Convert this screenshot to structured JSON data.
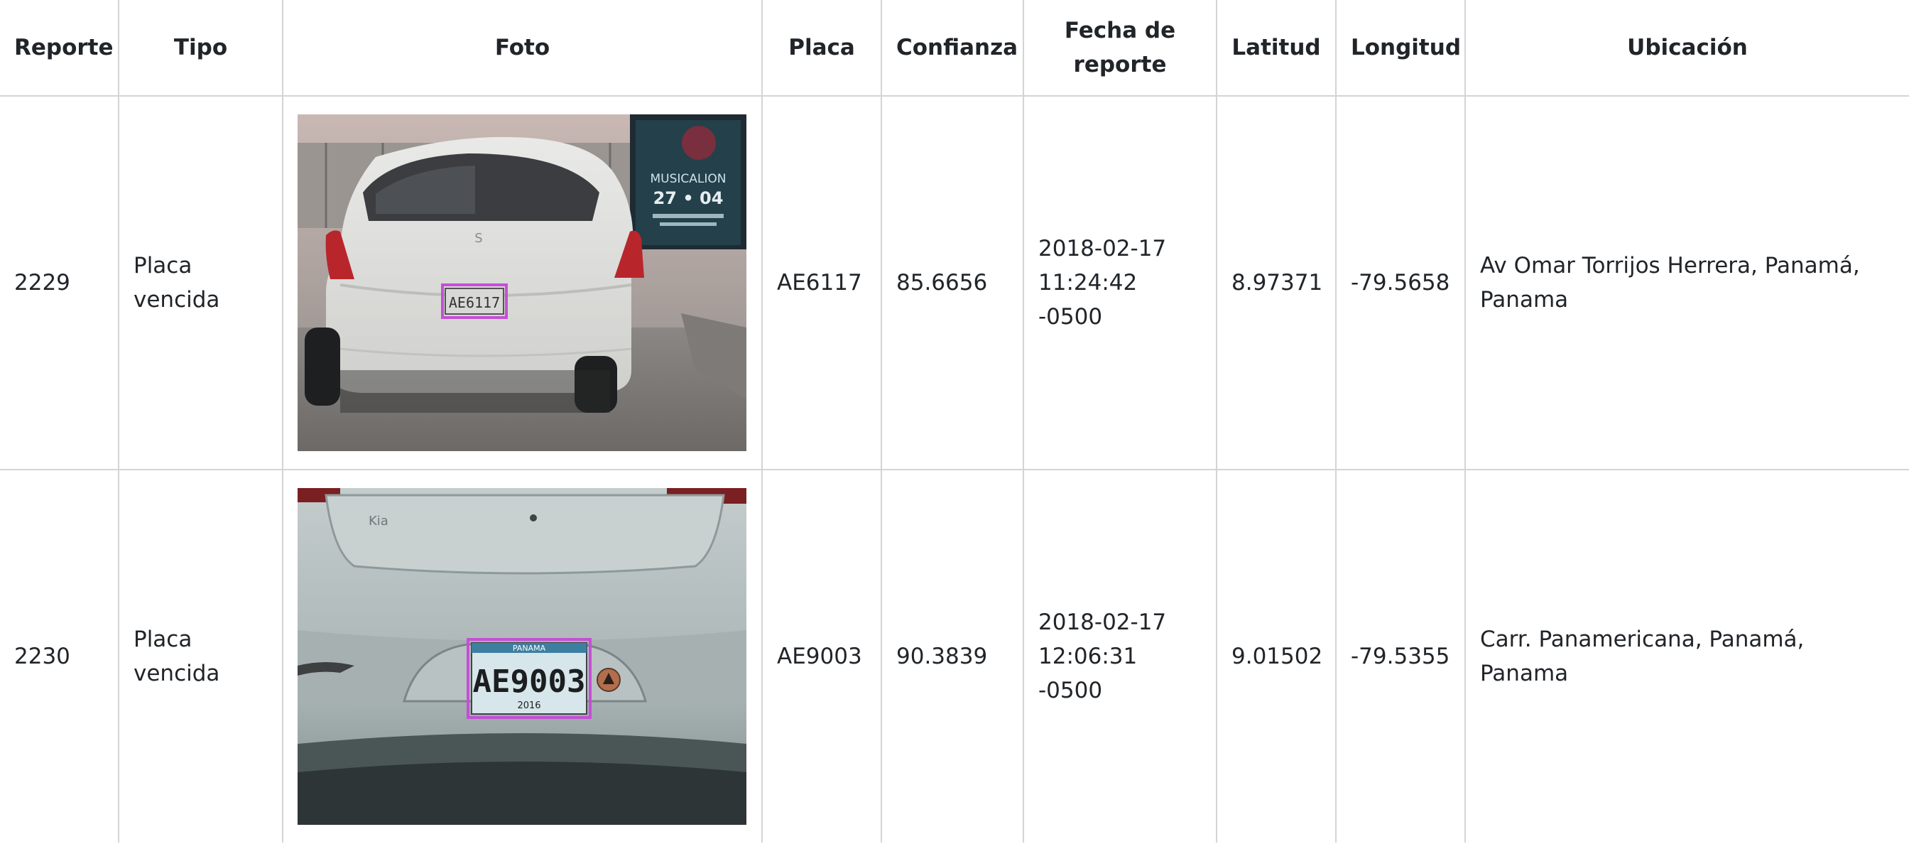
{
  "table": {
    "headers": {
      "reporte": "Reporte",
      "tipo": "Tipo",
      "foto": "Foto",
      "placa": "Placa",
      "confianza": "Confianza",
      "fecha_line1": "Fecha de",
      "fecha_line2": "reporte",
      "latitud": "Latitud",
      "longitud": "Longitud",
      "ubicacion": "Ubicación"
    },
    "rows": [
      {
        "reporte": "2229",
        "tipo_line1": "Placa",
        "tipo_line2": "vencida",
        "placa": "AE6117",
        "confianza": "85.6656",
        "fecha_line1": "2018-02-17",
        "fecha_line2": "11:24:42 -0500",
        "latitud": "8.97371",
        "longitud": "-79.5658",
        "ubicacion_line1": "Av Omar Torrijos Herrera, Panamá,",
        "ubicacion_line2": "Panama",
        "photo": {
          "plate_text": "AE6117",
          "sign_text_1": "MUSICALION",
          "sign_text_2": "27 • 04"
        }
      },
      {
        "reporte": "2230",
        "tipo_line1": "Placa",
        "tipo_line2": "vencida",
        "placa": "AE9003",
        "confianza": "90.3839",
        "fecha_line1": "2018-02-17",
        "fecha_line2": "12:06:31 -0500",
        "latitud": "9.01502",
        "longitud": "-79.5355",
        "ubicacion_line1": "Carr. Panamericana, Panamá, Panama",
        "ubicacion_line2": "",
        "photo": {
          "plate_text": "AE9003",
          "plate_country": "PANAMA",
          "plate_year": "2016"
        }
      }
    ]
  },
  "colors": {
    "border": "#d4d4d4",
    "text": "#212529",
    "detection_box": "#c44fd6"
  }
}
